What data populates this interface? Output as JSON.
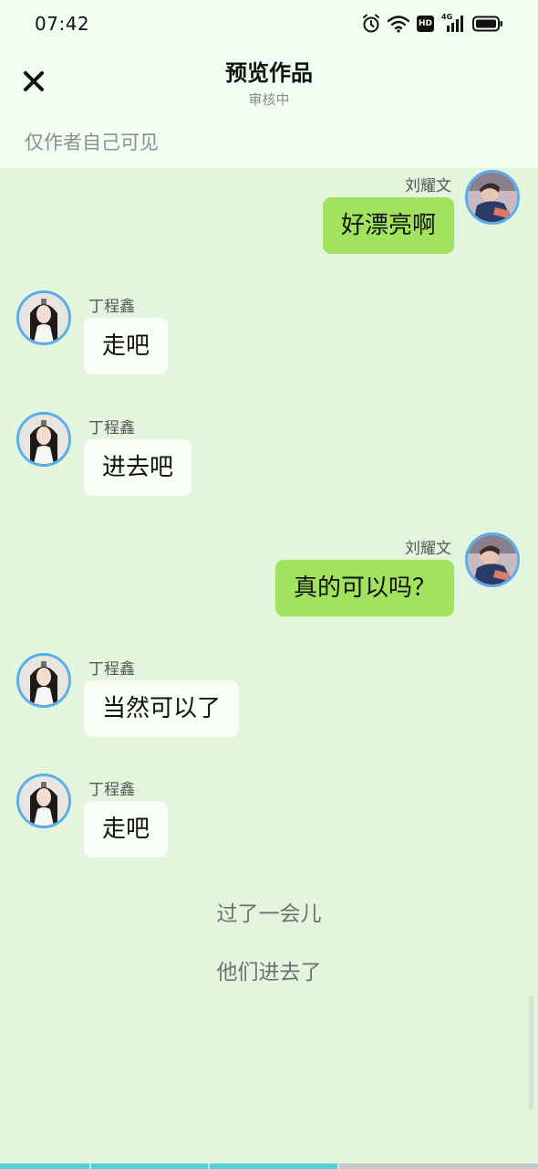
{
  "status_bar": {
    "time": "07:42",
    "icons": [
      "alarm-icon",
      "wifi-icon",
      "hd-icon",
      "signal-4g-icon",
      "battery-icon"
    ],
    "hd_label": "HD",
    "network_label": "4G"
  },
  "header": {
    "title": "预览作品",
    "subtitle": "审核中",
    "close_icon": "close-icon"
  },
  "visibility_note": "仅作者自己可见",
  "messages": [
    {
      "side": "right",
      "sender": "刘耀文",
      "text": "好漂亮啊"
    },
    {
      "side": "left",
      "sender": "丁程鑫",
      "text": "走吧"
    },
    {
      "side": "left",
      "sender": "丁程鑫",
      "text": "进去吧"
    },
    {
      "side": "right",
      "sender": "刘耀文",
      "text": "真的可以吗？"
    },
    {
      "side": "left",
      "sender": "丁程鑫",
      "text": "当然可以了"
    },
    {
      "side": "left",
      "sender": "丁程鑫",
      "text": "走吧"
    }
  ],
  "narrations": [
    "过了一会儿",
    "他们进去了"
  ],
  "progress": {
    "fraction": 0.63
  },
  "colors": {
    "background": "#e4f5de",
    "header_bg": "#f1fdf0",
    "right_bubble": "#a1e35e",
    "left_bubble": "#f8fdf6",
    "avatar_ring": "#5aaee8",
    "progress_fill": "#4fd0d8"
  }
}
